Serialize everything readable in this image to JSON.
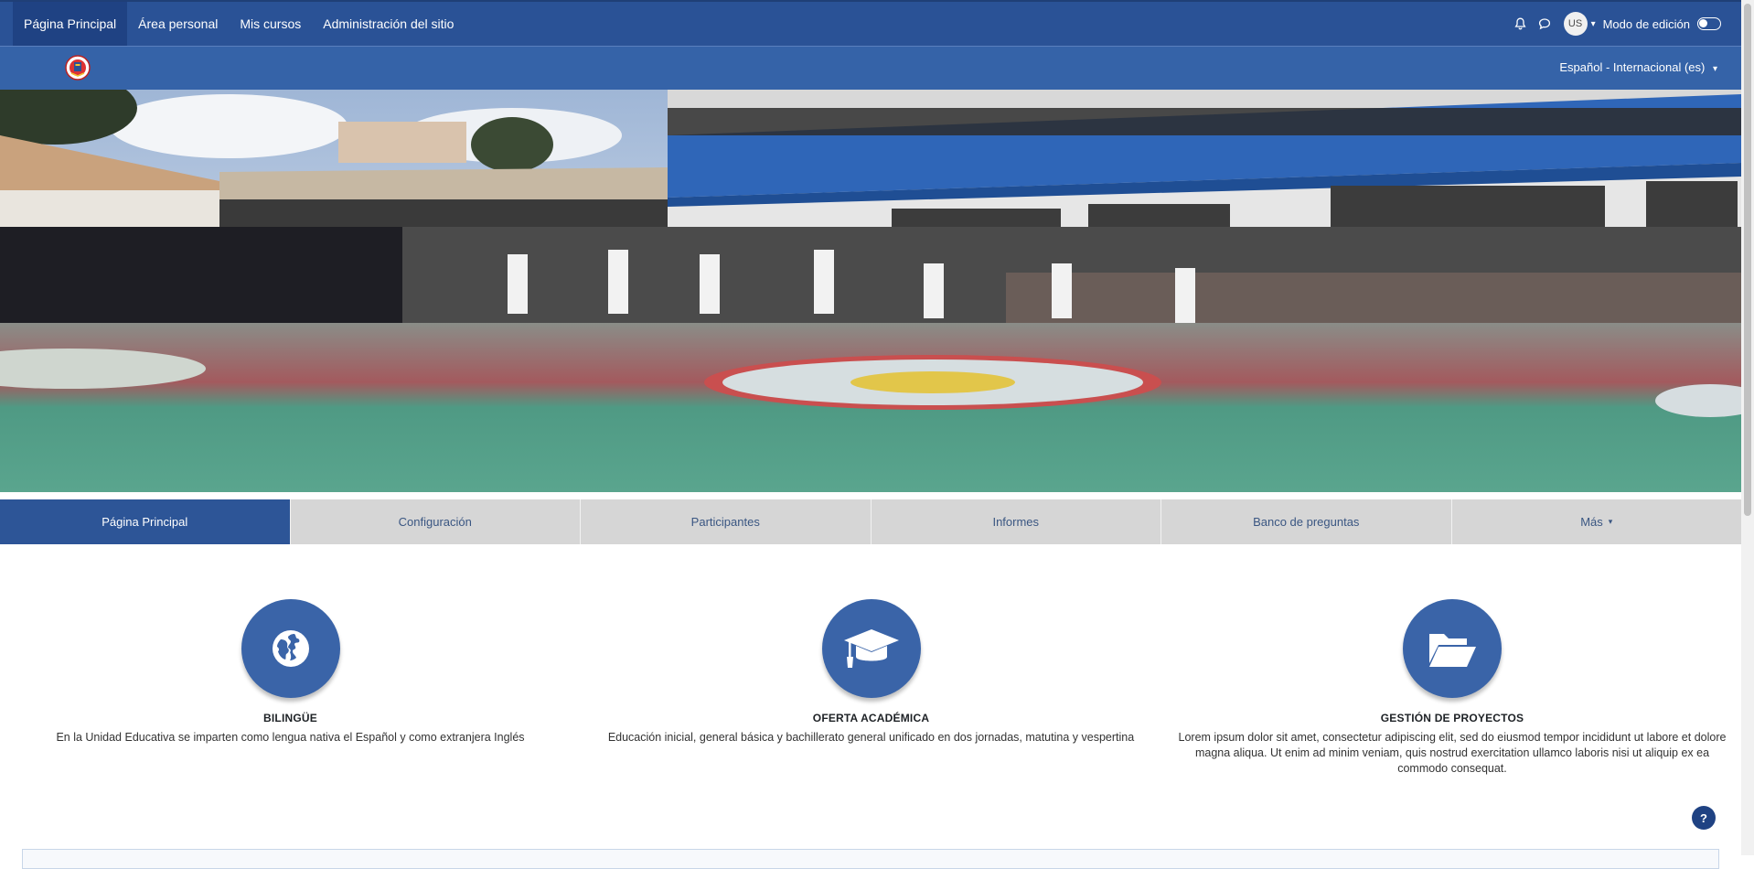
{
  "topnav": {
    "items": [
      "Página Principal",
      "Área personal",
      "Mis cursos",
      "Administración del sitio"
    ],
    "notifications_icon": "bell-icon",
    "messages_icon": "chat-icon",
    "user_initials": "US",
    "edit_mode_label": "Modo de edición"
  },
  "subbar": {
    "logo": "school-crest-logo",
    "language": "Español - Internacional (es)"
  },
  "tabs": [
    "Página Principal",
    "Configuración",
    "Participantes",
    "Informes",
    "Banco de preguntas",
    "Más"
  ],
  "features": [
    {
      "icon": "globe-icon",
      "title": "BILINGÜE",
      "text": "En la Unidad Educativa se imparten como lengua nativa el Español y como extranjera Inglés"
    },
    {
      "icon": "graduation-cap-icon",
      "title": "OFERTA ACADÉMICA",
      "text": "Educación inicial, general básica y bachillerato general unificado en dos jornadas, matutina y vespertina"
    },
    {
      "icon": "folder-open-icon",
      "title": "GESTIÓN DE PROYECTOS",
      "text": "Lorem ipsum dolor sit amet, consectetur adipiscing elit, sed do eiusmod tempor incididunt ut labore et dolore magna aliqua. Ut enim ad minim veniam, quis nostrud exercitation ullamco laboris nisi ut aliquip ex ea commodo consequat."
    }
  ],
  "help_button": "?",
  "colors": {
    "navbar": "#2a5296",
    "subbar": "#3563a8",
    "tab_active": "#2d5597",
    "tab_inactive": "#d6d6d6",
    "feature_circle": "#3a64a8"
  }
}
